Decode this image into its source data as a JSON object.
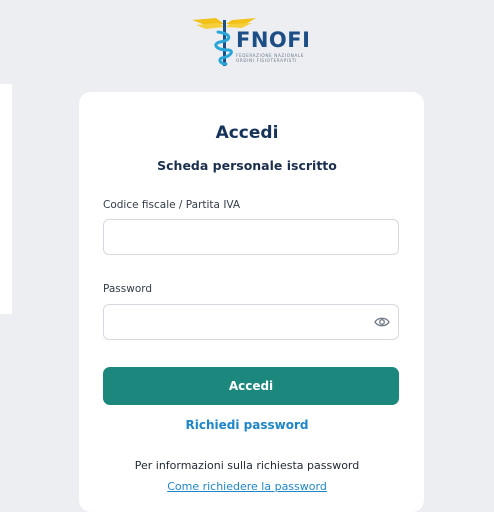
{
  "brand": {
    "name": "FNOFI",
    "subtitle_line1": "Federazione Nazionale",
    "subtitle_line2": "Ordini Fisioterapisti",
    "primary_color": "#1b877d",
    "link_color": "#1f86c7",
    "logo_wing_color": "#f2c11a",
    "logo_blue": "#1d4f86"
  },
  "login": {
    "title": "Accedi",
    "subtitle": "Scheda personale iscritto",
    "fiscal_code": {
      "label": "Codice fiscale / Partita IVA",
      "value": "",
      "placeholder": ""
    },
    "password": {
      "label": "Password",
      "value": "",
      "placeholder": "",
      "toggle_icon": "eye-icon"
    },
    "submit_label": "Accedi",
    "request_password_link": "Richiedi password",
    "info_text": "Per informazioni sulla richiesta password",
    "how_to_link": "Come richiedere la password"
  }
}
